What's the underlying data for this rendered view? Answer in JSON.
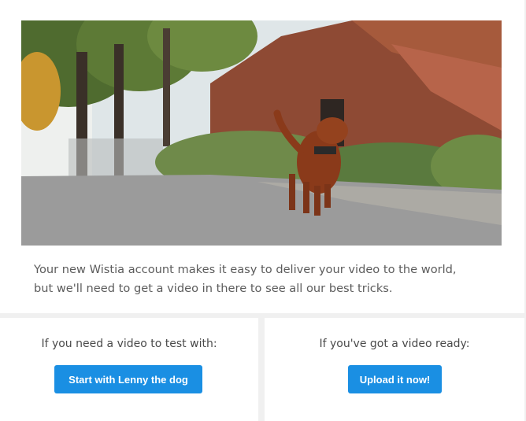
{
  "hero": {
    "image": "dog-carrying-object-on-street-photo"
  },
  "intro": {
    "line1": "Your new Wistia account makes it easy to deliver your video to the world,",
    "line2": "but we'll need to get a video in there to see all our best tricks."
  },
  "options": {
    "test": {
      "prompt": "If you need a video to test with:",
      "button_label": "Start with Lenny the dog"
    },
    "upload": {
      "prompt": "If you've got a video ready:",
      "button_label": "Upload it now!"
    }
  },
  "colors": {
    "accent": "#1a8fe3",
    "page_background": "#f0f0f0",
    "card_background": "#ffffff",
    "body_text": "#5c5c5c"
  }
}
